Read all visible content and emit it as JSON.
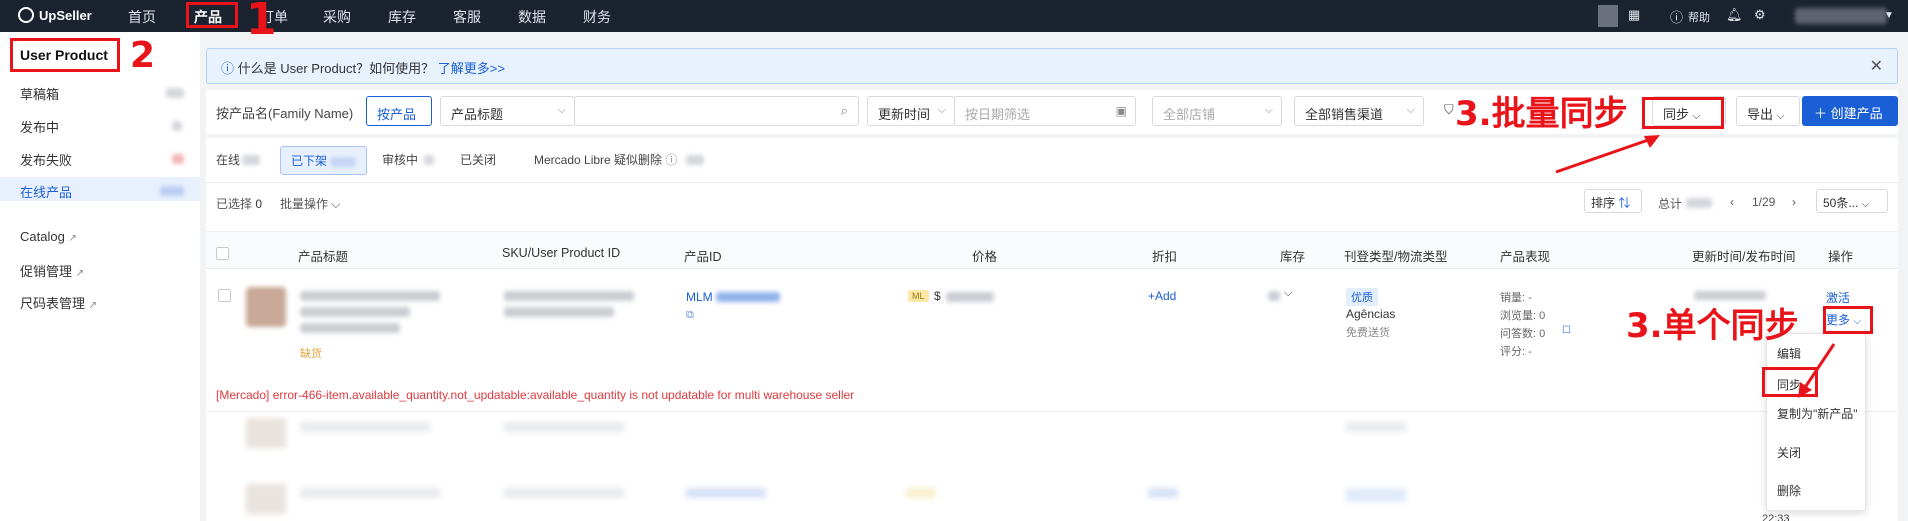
{
  "app": {
    "logo_text": "UpSeller"
  },
  "nav": {
    "items": [
      "首页",
      "产品",
      "订单",
      "采购",
      "库存",
      "客服",
      "数据",
      "财务"
    ],
    "active": "产品",
    "help_label": "帮助"
  },
  "sidebar": {
    "title": "User Product",
    "items": [
      "草稿箱",
      "发布中",
      "发布失败",
      "在线产品"
    ],
    "active": "在线产品",
    "links": [
      "Catalog",
      "促销管理",
      "尺码表管理"
    ]
  },
  "info": {
    "text": "什么是 User Product？如何使用？",
    "link": "了解更多>>"
  },
  "filters": {
    "by_family": "按产品名(Family Name)",
    "by_product": "按产品",
    "title_select": "产品标题",
    "time_select": "更新时间",
    "date_placeholder": "按日期筛选",
    "shop_placeholder": "全部店铺",
    "channel_select": "全部销售渠道",
    "sync_btn": "同步",
    "export_btn": "导出",
    "create_btn": "创建产品"
  },
  "status_tabs": [
    "在线",
    "已下架",
    "审核中",
    "已关闭",
    "Mercado Libre 疑似删除"
  ],
  "status_active": "已下架",
  "toolbar": {
    "selected_label": "已选择",
    "selected_count": "0",
    "batch": "批量操作",
    "sort": "排序",
    "total": "总计",
    "page": "1/29",
    "per_page": "50条..."
  },
  "table": {
    "headers": [
      "产品标题",
      "SKU/User Product ID",
      "产品ID",
      "价格",
      "折扣",
      "库存",
      "刊登类型/物流类型",
      "产品表现",
      "更新时间/发布时间",
      "操作"
    ],
    "row": {
      "tag": "缺货",
      "product_id_prefix": "MLM",
      "ml_badge": "ML",
      "price_prefix": "$",
      "discount": "+Add",
      "listing_badge": "优质",
      "logistics": "Agências",
      "shipping": "免费送货",
      "perf": [
        "销量: -",
        "浏览量: 0",
        "问答数: 0",
        "评分: -"
      ],
      "action_activate": "激活",
      "action_more": "更多",
      "error": "[Mercado] error-466-item.available_quantity.not_updatable:available_quantity is not updatable for multi warehouse seller",
      "partial_time": "22:33"
    }
  },
  "more_menu": [
    "编辑",
    "同步",
    "复制为\"新产品\"",
    "关闭",
    "删除"
  ],
  "annotations": {
    "n1": "1",
    "n2": "2",
    "batch_sync": "3.批量同步",
    "single_sync": "3.单个同步"
  },
  "colors": {
    "accent": "#1a5fd6",
    "nav_bg": "#1c2330",
    "annotation": "#e8141a",
    "error": "#e0393e"
  }
}
